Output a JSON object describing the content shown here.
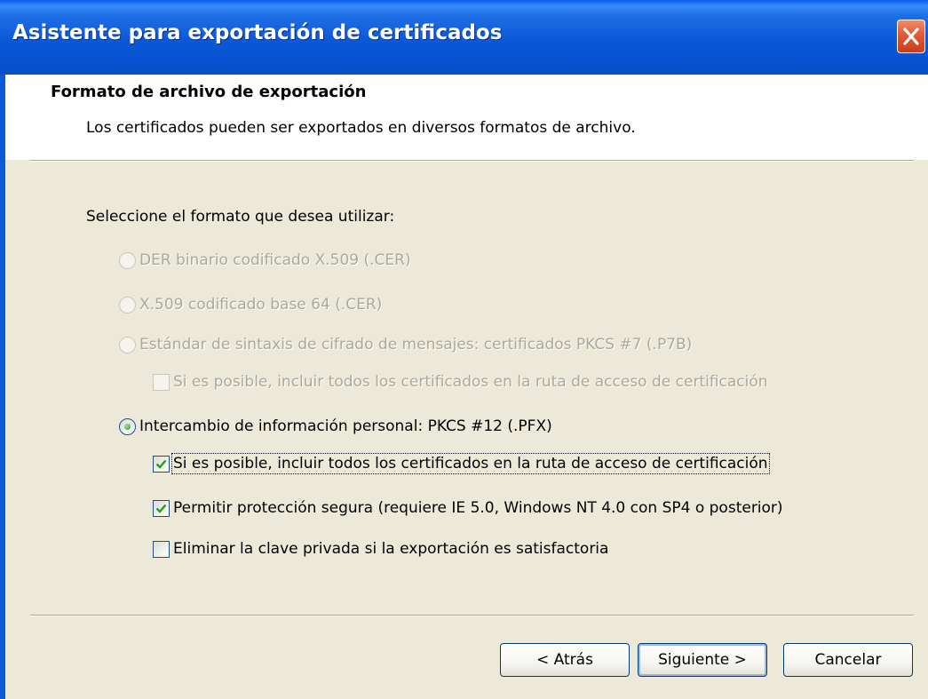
{
  "window": {
    "title": "Asistente para exportación de certificados",
    "close_icon": "close-icon"
  },
  "header": {
    "title": "Formato de archivo de exportación",
    "subtitle": "Los certificados pueden ser exportados en diversos formatos de archivo."
  },
  "body": {
    "prompt": "Seleccione el formato que desea utilizar:",
    "options": [
      {
        "label": "DER binario codificado X.509 (.CER)",
        "selected": false,
        "enabled": false
      },
      {
        "label": "X.509 codificado base 64 (.CER)",
        "selected": false,
        "enabled": false
      },
      {
        "label": "Estándar de sintaxis de cifrado de mensajes: certificados PKCS #7 (.P7B)",
        "selected": false,
        "enabled": false
      },
      {
        "label": "Intercambio de información personal: PKCS #12 (.PFX)",
        "selected": true,
        "enabled": true
      }
    ],
    "p7b_checkbox": {
      "label": "Si es posible, incluir todos los certificados en la ruta de acceso de certificación",
      "checked": false,
      "enabled": false
    },
    "pfx_checkboxes": [
      {
        "label": "Si es posible, incluir todos los certificados en la ruta de acceso de certificación",
        "checked": true,
        "enabled": true
      },
      {
        "label": "Permitir protección segura (requiere IE 5.0, Windows NT 4.0 con SP4 o posterior)",
        "checked": true,
        "enabled": true
      },
      {
        "label": "Eliminar la clave privada si la exportación es satisfactoria",
        "checked": false,
        "enabled": true
      }
    ]
  },
  "buttons": {
    "back": "< Atrás",
    "next": "Siguiente >",
    "cancel": "Cancelar"
  },
  "colors": {
    "titlebar": "#0b58d8",
    "face": "#ece9d8",
    "disabled_text": "#aca899",
    "check_green": "#21a121"
  }
}
